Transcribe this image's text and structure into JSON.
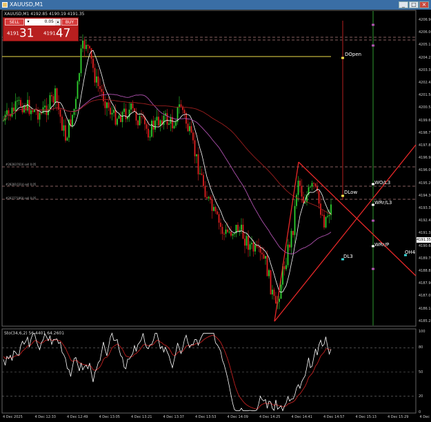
{
  "window": {
    "title": "XAUUSD,M1",
    "minimize": "_",
    "maximize": "□",
    "close": "×"
  },
  "header": {
    "info": "XAUUSD,M1  4192.85 4190.19 4191.35"
  },
  "trade_panel": {
    "sell_label": "SELL",
    "buy_label": "BUY",
    "lot": "0.05",
    "sell_price_small": "4191",
    "sell_price_big": "31",
    "buy_price_small": "4191",
    "buy_price_big": "47"
  },
  "levels": {
    "dopen": "DOpen",
    "dlow": "DLow",
    "dl3": "DL3",
    "wol3": "WO/L3",
    "wrl3": "WRr/L3",
    "wrp": "WRr/P",
    "oh4": "OH4"
  },
  "orders": [
    "#282837616 sell 0.05",
    "#282810314 sell 0.05",
    "#282771860 sell 0.05"
  ],
  "y_axis": [
    "4206.90",
    "4206.00",
    "4205.11",
    "4204.22",
    "4203.33",
    "4202.43",
    "4201.54",
    "4200.55",
    "4199.66",
    "4198.77",
    "4197.87",
    "4196.98",
    "4196.09",
    "4195.20",
    "4194.30",
    "4193.31",
    "4192.42",
    "4191.35",
    "4190.64",
    "4189.74",
    "4188.85",
    "4187.96",
    "4187.07",
    "4186.18",
    "4185.28"
  ],
  "current_price": "4191.35",
  "x_axis": [
    "4 Dec 2025",
    "4 Dec 12:33",
    "4 Dec 12:49",
    "4 Dec 13:05",
    "4 Dec 13:21",
    "4 Dec 13:37",
    "4 Dec 13:53",
    "4 Dec 14:09",
    "4 Dec 14:25",
    "4 Dec 14:41",
    "4 Dec 14:57",
    "4 Dec 15:13",
    "4 Dec 15:29",
    "4 Dec 15:45"
  ],
  "oscillator": {
    "title": "Sto(34,6,2) 56.4401 64.2601",
    "y_axis": [
      "100",
      "80",
      "50",
      "20",
      "0"
    ],
    "levels": [
      80,
      50,
      20
    ]
  },
  "colors": {
    "bull": "#2fd12f",
    "bear": "#e02020",
    "ma_white": "#ffffff",
    "ma_purple": "#b052b0",
    "ma_darkred": "#9b1e1e",
    "triangle": "#e82828",
    "dopen_line": "#f0e04a",
    "vertical_green": "#2e9a2e"
  }
}
